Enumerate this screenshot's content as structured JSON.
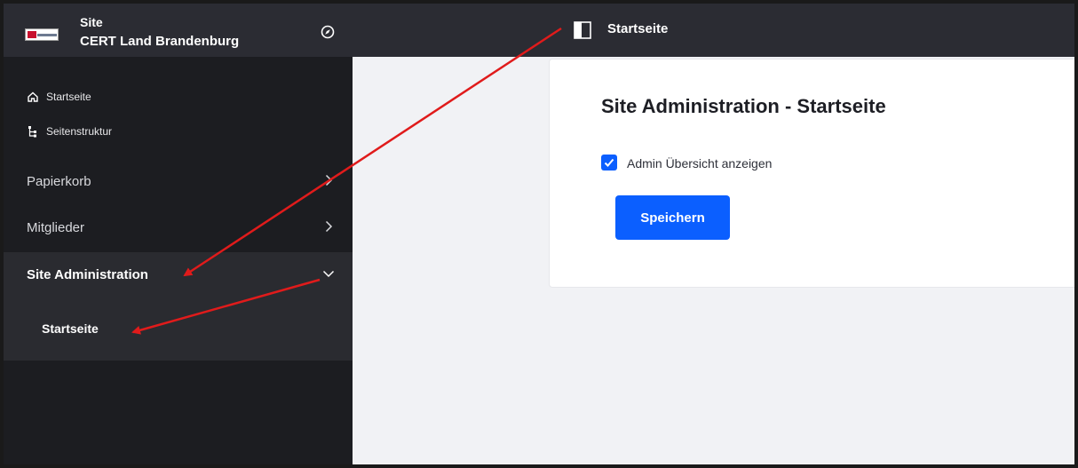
{
  "site": {
    "label": "Site",
    "name": "CERT Land Brandenburg"
  },
  "sidebar": {
    "quick_links": [
      {
        "label": "Startseite",
        "icon": "home-icon"
      },
      {
        "label": "Seitenstruktur",
        "icon": "tree-icon"
      }
    ],
    "sections": [
      {
        "label": "Papierkorb",
        "icon": "chevron-right-icon"
      },
      {
        "label": "Mitglieder",
        "icon": "chevron-right-icon"
      },
      {
        "label": "Site Administration",
        "icon": "chevron-down-icon",
        "expanded": true
      }
    ],
    "submenu": [
      {
        "label": "Startseite",
        "selected": true
      }
    ]
  },
  "topbar": {
    "title": "Startseite",
    "toggle_icon": "panel-toggle-icon"
  },
  "main": {
    "heading": "Site Administration - Startseite",
    "checkbox": {
      "label": "Admin Übersicht anzeigen",
      "checked": true
    },
    "save_label": "Speichern"
  },
  "colors": {
    "sidebar_bg": "#1c1d21",
    "header_bg": "#2b2c33",
    "primary": "#0b5fff",
    "arrow": "#e01b1b"
  }
}
